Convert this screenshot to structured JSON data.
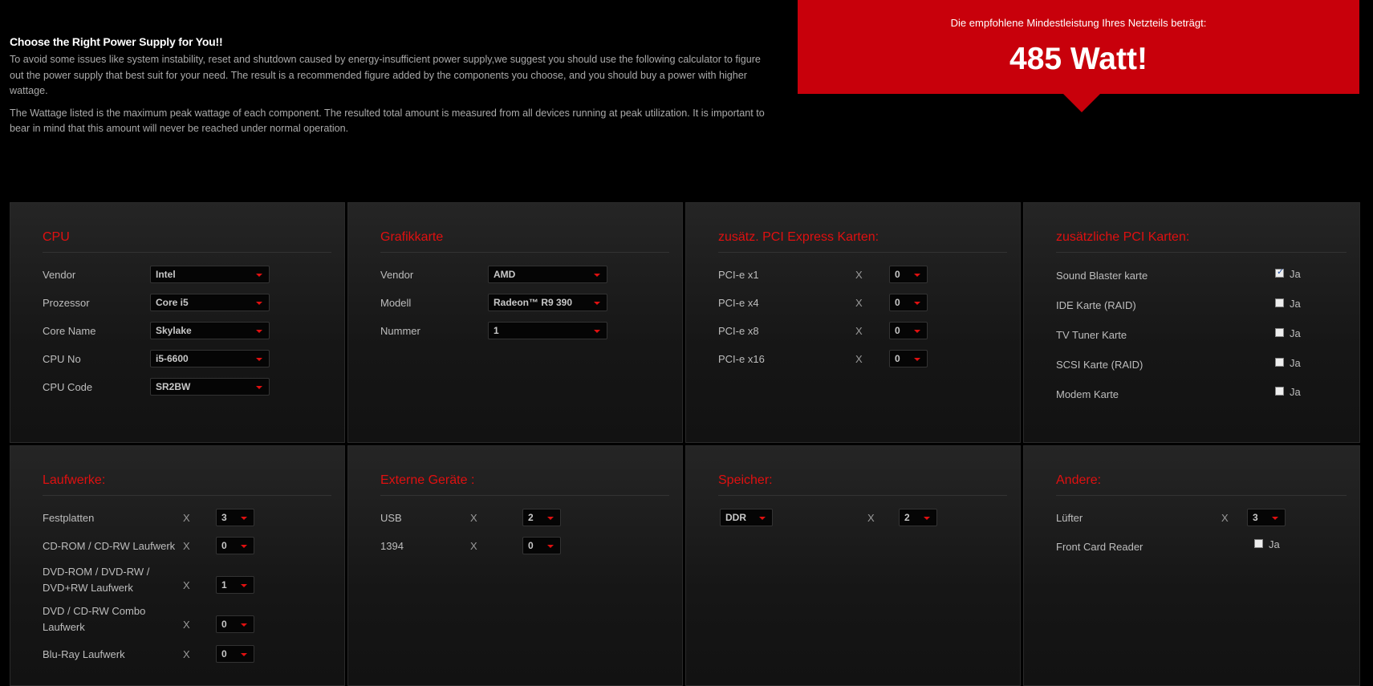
{
  "intro": {
    "title": "Choose the Right Power Supply for You!!",
    "p1": "To avoid some issues like system instability, reset and shutdown caused by energy-insufficient power supply,we suggest you should use the following calculator to figure out the power supply that best suit for your need. The result is a recommended figure added by the components you choose, and you should buy a power with higher wattage.",
    "p2": "The Wattage listed is the maximum peak wattage of each component. The resulted total amount is measured from all devices running at peak utilization. It is important to bear in mind that this amount will never be reached under normal operation."
  },
  "result": {
    "label": "Die empfohlene Mindestleistung Ihres Netzteils beträgt:",
    "value": "485 Watt!"
  },
  "cpu": {
    "title": "CPU",
    "vendor_label": "Vendor",
    "vendor_value": "Intel",
    "proz_label": "Prozessor",
    "proz_value": "Core i5",
    "core_label": "Core Name",
    "core_value": "Skylake",
    "no_label": "CPU No",
    "no_value": "i5-6600",
    "code_label": "CPU Code",
    "code_value": "SR2BW"
  },
  "gpu": {
    "title": "Grafikkarte",
    "vendor_label": "Vendor",
    "vendor_value": "AMD",
    "model_label": "Modell",
    "model_value": "Radeon™ R9 390",
    "num_label": "Nummer",
    "num_value": "1"
  },
  "pcie": {
    "title": "zusätz. PCI Express Karten:",
    "x": "X",
    "x1_label": "PCI-e x1",
    "x1_value": "0",
    "x4_label": "PCI-e x4",
    "x4_value": "0",
    "x8_label": "PCI-e x8",
    "x8_value": "0",
    "x16_label": "PCI-e x16",
    "x16_value": "0"
  },
  "pci": {
    "title": "zusätzliche PCI Karten:",
    "ja": "Ja",
    "sound_label": "Sound Blaster karte",
    "sound_checked": true,
    "ide_label": "IDE Karte (RAID)",
    "ide_checked": false,
    "tv_label": "TV Tuner Karte",
    "tv_checked": false,
    "scsi_label": "SCSI Karte (RAID)",
    "scsi_checked": false,
    "modem_label": "Modem Karte",
    "modem_checked": false
  },
  "drives": {
    "title": "Laufwerke:",
    "x": "X",
    "hdd_label": "Festplatten",
    "hdd_value": "3",
    "cd_label": "CD-ROM / CD-RW Laufwerk",
    "cd_value": "0",
    "dvd_label": "DVD-ROM / DVD-RW / DVD+RW Laufwerk",
    "dvd_value": "1",
    "combo_label": "DVD / CD-RW Combo Laufwerk",
    "combo_value": "0",
    "bluray_label": "Blu-Ray Laufwerk",
    "bluray_value": "0"
  },
  "ext": {
    "title": "Externe Geräte :",
    "x": "X",
    "usb_label": "USB",
    "usb_value": "2",
    "fw_label": "1394",
    "fw_value": "0"
  },
  "mem": {
    "title": "Speicher:",
    "x": "X",
    "type_value": "DDR",
    "count_value": "2"
  },
  "other": {
    "title": "Andere:",
    "x": "X",
    "ja": "Ja",
    "fan_label": "Lüfter",
    "fan_value": "3",
    "reader_label": "Front Card Reader",
    "reader_checked": false
  },
  "colors": {
    "accent": "#c8000b",
    "heading": "#e01010",
    "background": "#000000"
  }
}
